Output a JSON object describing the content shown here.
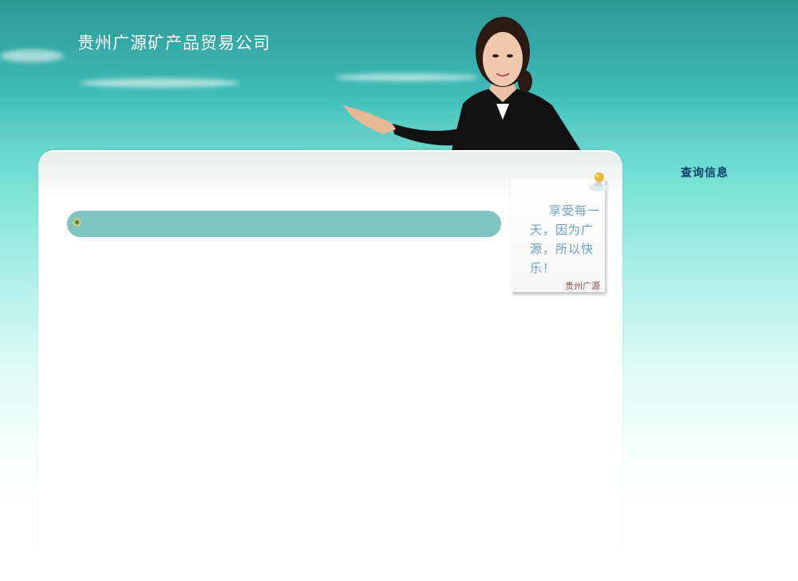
{
  "header": {
    "company_name": "贵州广源矿产品贸易公司"
  },
  "main": {
    "bar_label": ""
  },
  "note": {
    "text": "享受每一天，因为广源，所以快乐！",
    "signature": "贵州广源"
  },
  "sidebar": {
    "title": "查询信息"
  },
  "colors": {
    "bar": "#7fc4c0",
    "note_text": "#6d9fc7",
    "sidebar_title": "#0d3f6e"
  },
  "icons": {
    "bar_bullet": "circle-bullet-icon",
    "note_pin": "pushpin-icon"
  }
}
